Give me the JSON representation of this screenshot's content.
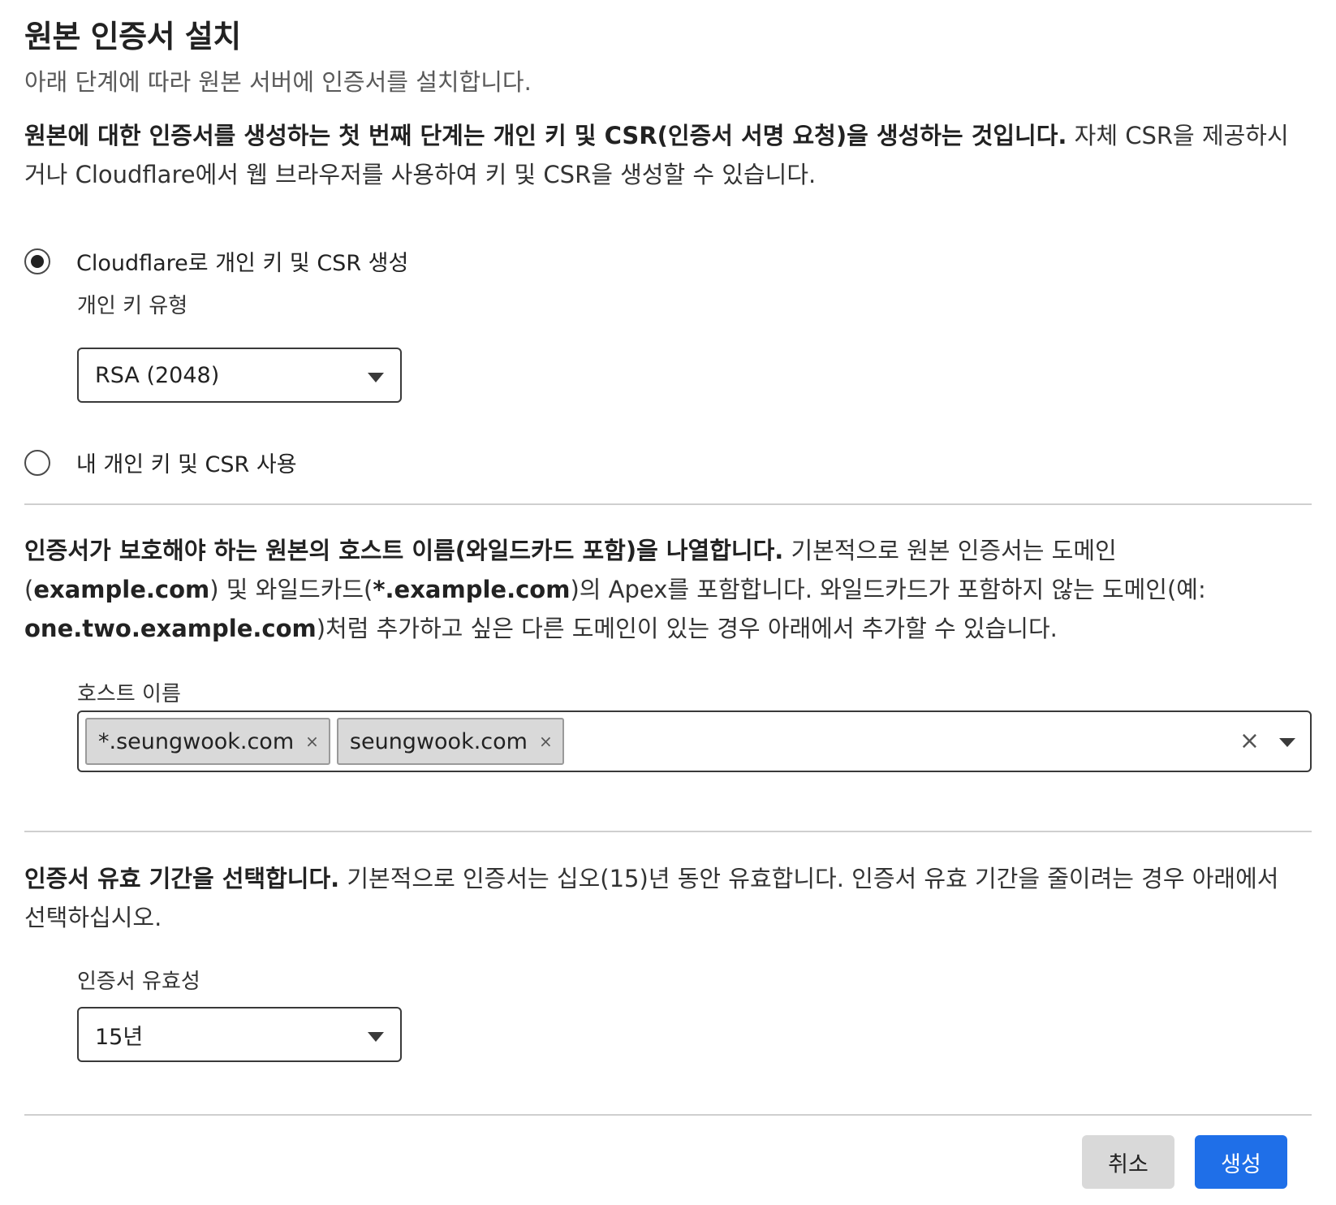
{
  "header": {
    "title": "원본 인증서 설치",
    "subtitle": "아래 단계에 따라 원본 서버에 인증서를 설치합니다."
  },
  "csr_section": {
    "intro_bold": "원본에 대한 인증서를 생성하는 첫 번째 단계는 개인 키 및 CSR(인증서 서명 요청)을 생성하는 것입니다.",
    "intro_text": " 자체 CSR을 제공하시거나 Cloudflare에서 웹 브라우저를 사용하여 키 및 CSR을 생성할 수 있습니다.",
    "option_generate": {
      "label": "Cloudflare로 개인 키 및 CSR 생성",
      "checked": true
    },
    "key_type_label": "개인 키 유형",
    "key_type_value": "RSA (2048)",
    "option_own": {
      "label": "내 개인 키 및 CSR 사용",
      "checked": false
    }
  },
  "hostnames_section": {
    "p_bold1": "인증서가 보호해야 하는 원본의 호스트 이름(와일드카드 포함)을 나열합니다.",
    "p_t1": " 기본적으로 원본 인증서는 도메인 (",
    "p_b2": "example.com",
    "p_t2": ") 및 와일드카드(",
    "p_b3": "*.example.com",
    "p_t3": ")의 Apex를 포함합니다. 와일드카드가 포함하지 않는 도메인(예: ",
    "p_b4": "one.two.example.com",
    "p_t4": ")처럼 추가하고 싶은 다른 도메인이 있는 경우 아래에서 추가할 수 있습니다.",
    "field_label": "호스트 이름",
    "tags": [
      "*.seungwook.com",
      "seungwook.com"
    ],
    "tag_remove": "×",
    "clear": "×"
  },
  "validity_section": {
    "p_bold": "인증서 유효 기간을 선택합니다.",
    "p_text": " 기본적으로 인증서는 십오(15)년 동안 유효합니다. 인증서 유효 기간을 줄이려는 경우 아래에서 선택하십시오.",
    "field_label": "인증서 유효성",
    "value": "15년"
  },
  "footer": {
    "cancel_label": "취소",
    "create_label": "생성"
  },
  "colors": {
    "primary": "#1f6fe8",
    "cancel_bg": "#d9d9d9",
    "divider": "#cfcfcf"
  },
  "icons": {
    "select_caret": "caret-down-icon",
    "tag_remove": "close-icon"
  }
}
